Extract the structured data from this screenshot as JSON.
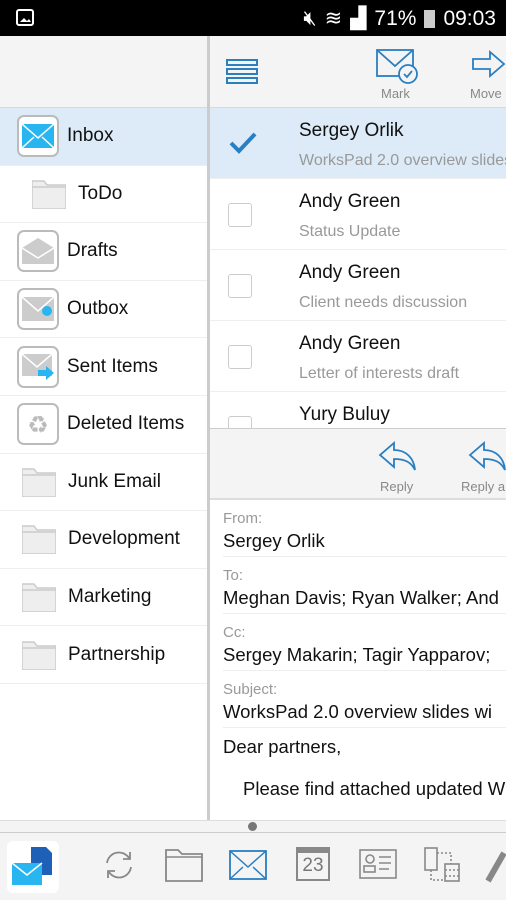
{
  "status_bar": {
    "battery": "71%",
    "time": "09:03"
  },
  "toolbar": {
    "mark_label": "Mark",
    "move_label": "Move"
  },
  "folders": [
    {
      "label": "Inbox",
      "icon": "inbox-icon",
      "selected": true
    },
    {
      "label": "ToDo",
      "icon": "folder-icon",
      "sub": true
    },
    {
      "label": "Drafts",
      "icon": "drafts-icon"
    },
    {
      "label": "Outbox",
      "icon": "outbox-icon"
    },
    {
      "label": "Sent Items",
      "icon": "sent-icon"
    },
    {
      "label": "Deleted Items",
      "icon": "recycle-icon"
    },
    {
      "label": "Junk Email",
      "icon": "folder-icon"
    },
    {
      "label": "Development",
      "icon": "folder-icon"
    },
    {
      "label": "Marketing",
      "icon": "folder-icon"
    },
    {
      "label": "Partnership",
      "icon": "folder-icon"
    }
  ],
  "messages": [
    {
      "sender": "Sergey Orlik",
      "subject": "WorksPad 2.0 overview slides",
      "checked": true
    },
    {
      "sender": "Andy Green",
      "subject": "Status Update",
      "checked": false
    },
    {
      "sender": "Andy Green",
      "subject": "Client needs discussion",
      "checked": false
    },
    {
      "sender": "Andy Green",
      "subject": "Letter of interests draft",
      "checked": false
    },
    {
      "sender": "Yury Buluy",
      "subject": "",
      "checked": false
    }
  ],
  "detail_toolbar": {
    "reply_label": "Reply",
    "reply_all_label": "Reply a"
  },
  "detail": {
    "from_label": "From:",
    "from": "Sergey Orlik",
    "to_label": "To:",
    "to": "Meghan Davis; Ryan Walker; And",
    "cc_label": "Cc:",
    "cc": "Sergey Makarin; Tagir Yapparov;",
    "subject_label": "Subject:",
    "subject": "WorksPad 2.0 overview slides wi",
    "body_greeting": "Dear partners,",
    "body_line": "Please find attached updated W"
  },
  "bottom_bar": {
    "calendar_day": "23"
  },
  "colors": {
    "accent": "#2a7fc1",
    "selected": "#dcebf7",
    "inbox_blue": "#29b6f0"
  }
}
